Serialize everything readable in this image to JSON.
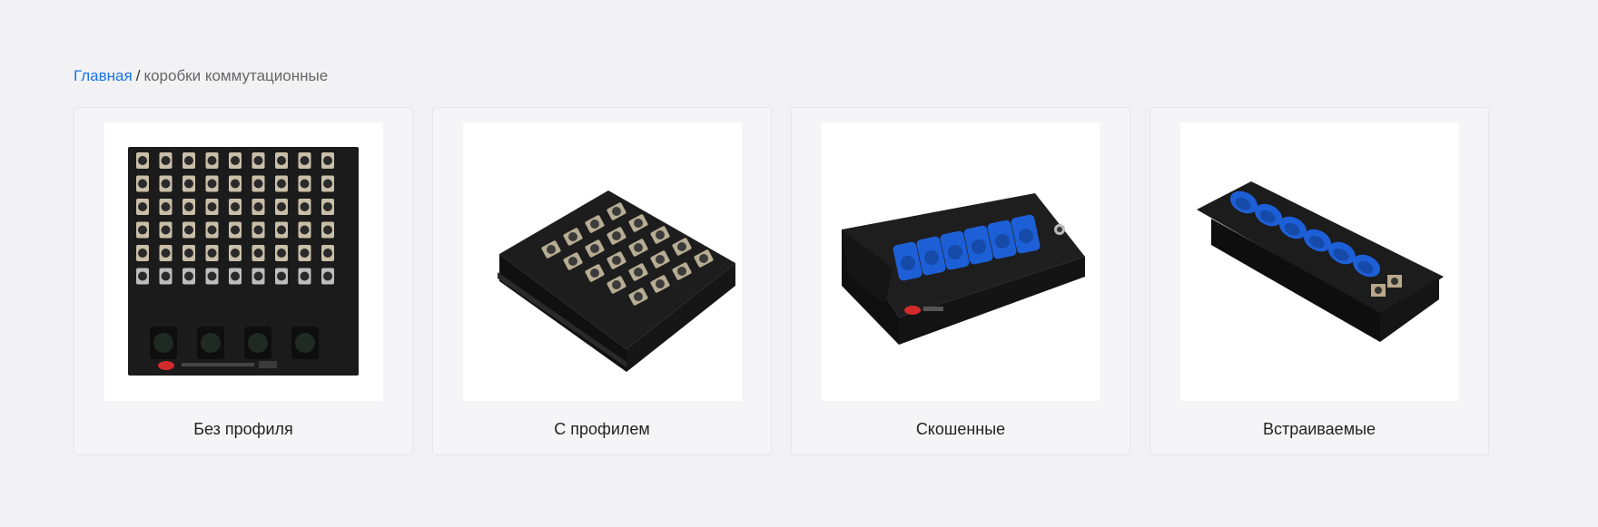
{
  "breadcrumb": {
    "home_label": "Главная",
    "separator": "/",
    "current_label": "коробки коммутационные"
  },
  "categories": [
    {
      "label": "Без профиля",
      "image_icon": "flat-panel-box-image"
    },
    {
      "label": "С профилем",
      "image_icon": "profile-box-image"
    },
    {
      "label": "Скошенные",
      "image_icon": "angled-box-image"
    },
    {
      "label": "Встраиваемые",
      "image_icon": "recessed-box-image"
    }
  ],
  "colors": {
    "link": "#1a73e8",
    "page_bg": "#f2f2f4",
    "card_bg": "#f5f5f7",
    "socket_blue": "#1d5fd6"
  }
}
